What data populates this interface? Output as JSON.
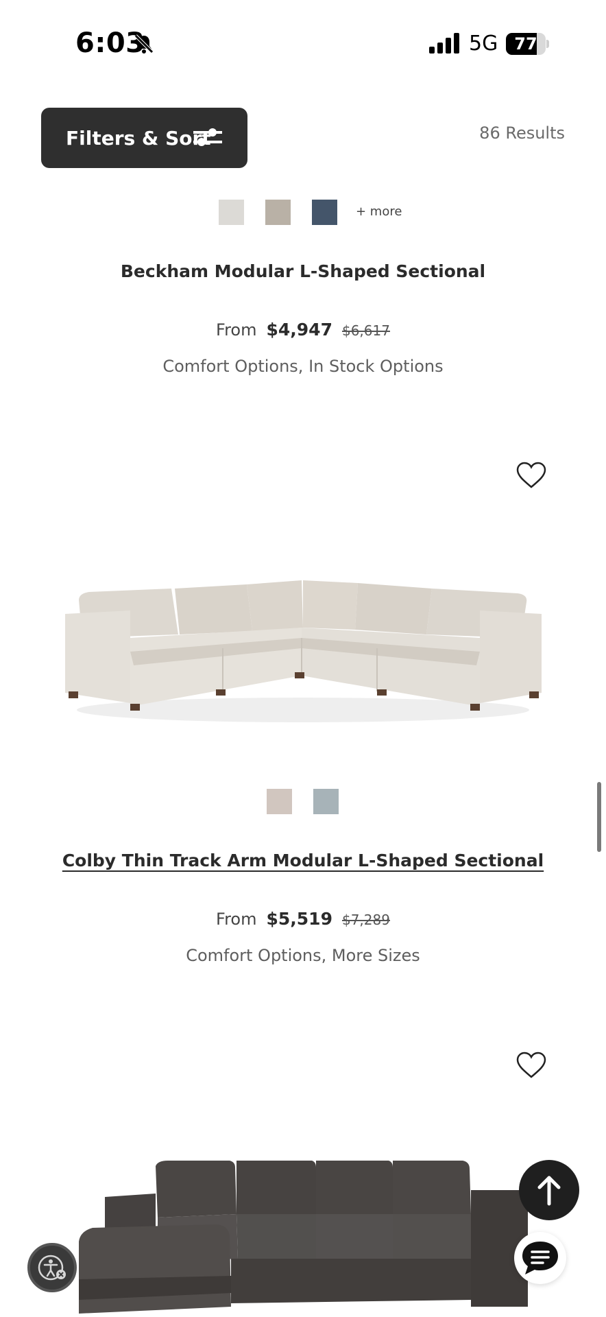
{
  "status_bar": {
    "time": "6:03",
    "network": "5G",
    "battery_percent": "77",
    "battery_level": 0.77
  },
  "toolbar": {
    "filters_label": "Filters & Sort",
    "results_label": "86 Results"
  },
  "products": [
    {
      "name": "Beckham Modular L-Shaped Sectional",
      "from_label": "From",
      "price": "$4,947",
      "original_price": "$6,617",
      "options": "Comfort Options, In Stock Options",
      "swatches": [
        "#dcdad6",
        "#b9b1a6",
        "#44556a"
      ],
      "more_label": "+ more"
    },
    {
      "name": "Colby Thin Track Arm Modular L-Shaped Sectional",
      "from_label": "From",
      "price": "$5,519",
      "original_price": "$7,289",
      "options": "Comfort Options, More Sizes",
      "swatches": [
        "#d1c6bf",
        "#a7b3b8"
      ],
      "image_icon": "sofa-image-light-sectional"
    },
    {
      "image_icon": "sofa-image-dark-leather-sectional"
    }
  ],
  "icons": {
    "heart": "heart-icon",
    "scroll_top": "arrow-up-icon",
    "chat": "chat-icon",
    "accessibility": "accessibility-icon"
  }
}
